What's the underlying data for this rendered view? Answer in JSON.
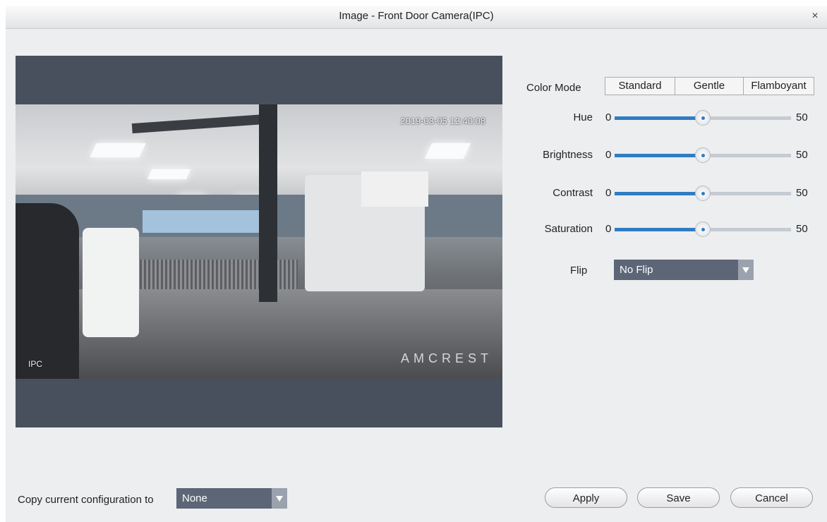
{
  "window": {
    "title": "Image - Front Door Camera(IPC)",
    "close_glyph": "×"
  },
  "preview": {
    "timestamp": "2019-03-05 12:40:08",
    "channel_label": "IPC",
    "watermark": "AMCREST"
  },
  "color_mode": {
    "label": "Color Mode",
    "options": [
      "Standard",
      "Gentle",
      "Flamboyant"
    ]
  },
  "sliders": [
    {
      "label": "Hue",
      "min": "0",
      "max": "50",
      "fraction": 0.5
    },
    {
      "label": "Brightness",
      "min": "0",
      "max": "50",
      "fraction": 0.5
    },
    {
      "label": "Contrast",
      "min": "0",
      "max": "50",
      "fraction": 0.5
    },
    {
      "label": "Saturation",
      "min": "0",
      "max": "50",
      "fraction": 0.5
    }
  ],
  "flip": {
    "label": "Flip",
    "value": "No Flip"
  },
  "copy": {
    "label": "Copy current configuration to",
    "value": "None"
  },
  "buttons": {
    "apply": "Apply",
    "save": "Save",
    "cancel": "Cancel"
  },
  "colors": {
    "accent": "#2f7dc3",
    "dropdown": "#5c6677",
    "preview_bg": "#48505d"
  }
}
